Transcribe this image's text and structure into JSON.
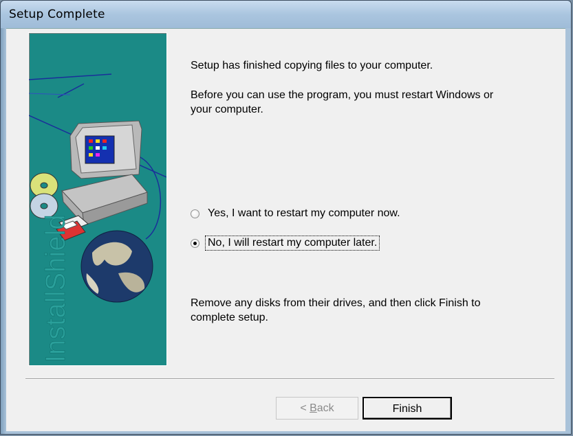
{
  "window": {
    "title": "Setup Complete"
  },
  "banner": {
    "brand_text": "InstallShield"
  },
  "messages": {
    "finished": "Setup has finished copying files to your computer.",
    "restart_line1": "Before you can use the program, you must restart Windows or",
    "restart_line2": "your computer.",
    "remove_line1": "Remove any disks from their drives, and then click Finish to",
    "remove_line2": "complete setup."
  },
  "options": {
    "restart_now": {
      "label": "Yes, I want to restart my computer now.",
      "checked": false
    },
    "restart_later": {
      "label": "No, I will restart my computer later.",
      "checked": true
    }
  },
  "buttons": {
    "back_prefix": "< ",
    "back_mnemonic": "B",
    "back_rest": "ack",
    "finish": "Finish"
  },
  "colors": {
    "banner_teal": "#1b8a86",
    "title_bar": "#a9c2d9"
  }
}
